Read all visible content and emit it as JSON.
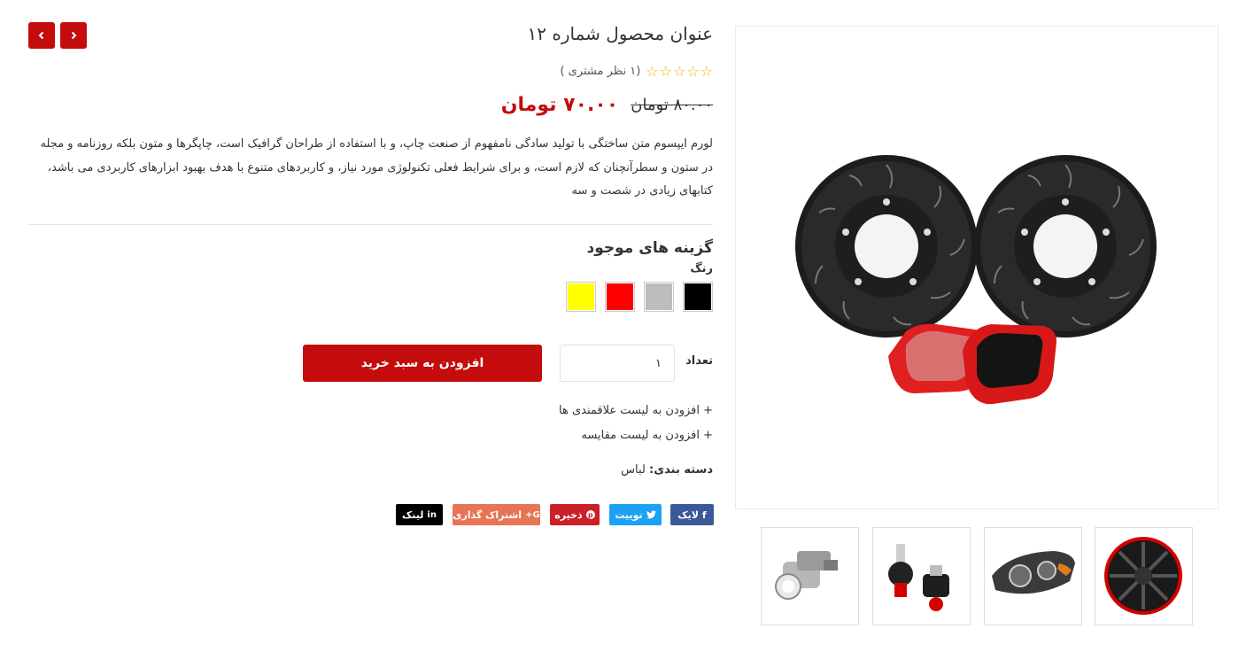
{
  "product": {
    "title": "عنوان محصول شماره ۱۲",
    "review_text": "(۱ نظر مشتری )",
    "rating_stars": 0,
    "old_price": "۸۰.۰۰ تومان",
    "new_price": "۷۰.۰۰ تومان",
    "description": "لورم ایپسوم متن ساختگی با تولید سادگی نامفهوم از صنعت چاپ، و با استفاده از طراحان گرافیک است، چاپگرها و متون بلکه روزنامه و مجله در ستون و سطرآنچنان که لازم است، و برای شرایط فعلی تکنولوژی مورد نیاز، و کاربردهای متنوع با هدف بهبود ابزارهای کاربردی می باشد، کتابهای زیادی در شصت و سه"
  },
  "options": {
    "title": "گزینه های موجود",
    "color_label": "رنگ",
    "colors": [
      "#000000",
      "#bdbdbd",
      "#ff0000",
      "#ffff00"
    ]
  },
  "cart": {
    "qty_label": "تعداد",
    "qty_value": "۱",
    "add_button": "افزودن به سبد خرید"
  },
  "links": {
    "wishlist": "+ افزودن به لیست علاقمندی ها",
    "compare": "+ افزودن به لیست مقایسه"
  },
  "category": {
    "label": "دسته بندی:",
    "value": "لباس"
  },
  "share": {
    "facebook": "لایک",
    "twitter": "توییت",
    "pinterest": "ذخیره",
    "google": "اشتراک گذاری",
    "linkedin": "لینک"
  },
  "colors": {
    "accent": "#c40c0c",
    "facebook": "#3b5998",
    "twitter": "#1da1f2",
    "pinterest": "#cb2027",
    "google": "#dd4b39",
    "linkedin": "#000000"
  }
}
